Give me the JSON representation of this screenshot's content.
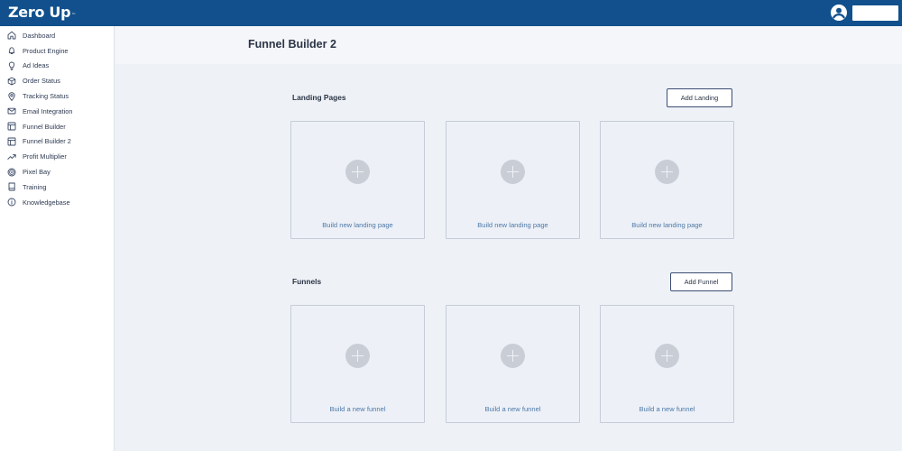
{
  "app": {
    "logo_text": "Zero Up",
    "logo_tm": "™",
    "user_icon": "account-circle-icon"
  },
  "sidebar": {
    "items": [
      {
        "label": "Dashboard",
        "icon": "home-icon"
      },
      {
        "label": "Product Engine",
        "icon": "bell-icon"
      },
      {
        "label": "Ad Ideas",
        "icon": "lightbulb-icon"
      },
      {
        "label": "Order Status",
        "icon": "package-icon"
      },
      {
        "label": "Tracking Status",
        "icon": "location-pin-icon"
      },
      {
        "label": "Email Integration",
        "icon": "mail-icon"
      },
      {
        "label": "Funnel Builder",
        "icon": "layout-icon"
      },
      {
        "label": "Funnel Builder 2",
        "icon": "layout-icon"
      },
      {
        "label": "Profit Multiplier",
        "icon": "trending-up-icon"
      },
      {
        "label": "Pixel Bay",
        "icon": "target-icon"
      },
      {
        "label": "Training",
        "icon": "book-icon"
      },
      {
        "label": "Knowledgebase",
        "icon": "info-icon"
      }
    ]
  },
  "page": {
    "title": "Funnel Builder 2"
  },
  "landing": {
    "title": "Landing Pages",
    "add_label": "Add Landing",
    "cards": [
      {
        "label": "Build new landing page"
      },
      {
        "label": "Build new landing page"
      },
      {
        "label": "Build new landing page"
      }
    ]
  },
  "funnels": {
    "title": "Funnels",
    "add_label": "Add Funnel",
    "cards": [
      {
        "label": "Build a new funnel"
      },
      {
        "label": "Build a new funnel"
      },
      {
        "label": "Build a new funnel"
      }
    ]
  },
  "colors": {
    "topbar": "#11508c",
    "card_label": "#4e78a8",
    "background": "#eef2f7"
  }
}
